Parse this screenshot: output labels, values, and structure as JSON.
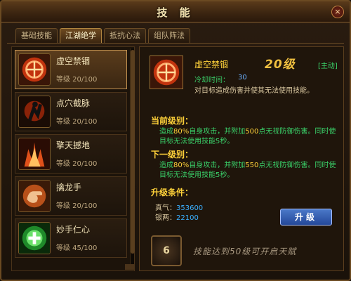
{
  "window": {
    "title": "技 能",
    "close_label": "×"
  },
  "tabs": [
    {
      "label": "基础技能",
      "active": false
    },
    {
      "label": "江湖绝学",
      "active": true
    },
    {
      "label": "抵抗心法",
      "active": false
    },
    {
      "label": "组队阵法",
      "active": false
    }
  ],
  "skills": [
    {
      "name": "虚空禁锢",
      "level": "等级 20/100",
      "selected": true,
      "icon": "knot-icon"
    },
    {
      "name": "点穴截脉",
      "level": "等级 20/100",
      "selected": false,
      "icon": "strike-icon"
    },
    {
      "name": "擎天撼地",
      "level": "等级 20/100",
      "selected": false,
      "icon": "fire-burst-icon"
    },
    {
      "name": "擒龙手",
      "level": "等级 20/100",
      "selected": false,
      "icon": "grab-hand-icon"
    },
    {
      "name": "妙手仁心",
      "level": "等级 45/100",
      "selected": false,
      "icon": "heal-cross-icon"
    }
  ],
  "detail": {
    "name": "虚空禁锢",
    "level": "20级",
    "type": "[主动]",
    "cooldown_label": "冷却时间：",
    "cooldown_value": "30",
    "description": "对目标造成伤害并使其无法使用技能。",
    "current_label": "当前级别：",
    "current_effect_pre": "造成",
    "current_effect_pct": "80%",
    "current_effect_mid": "自身攻击，并附加",
    "current_effect_add": "500",
    "current_effect_post": "点无视防御伤害。同时使目标无法使用技能5秒。",
    "next_label": "下一级别：",
    "next_effect_pre": "造成",
    "next_effect_pct": "80%",
    "next_effect_mid": "自身攻击，并附加",
    "next_effect_add": "550",
    "next_effect_post": "点无视防御伤害。同时使目标无法使用技能5秒。",
    "upgrade_label": "升级条件：",
    "zhenqi_label": "真气：",
    "zhenqi_value": "353600",
    "silver_label": "银两：",
    "silver_value": "22100",
    "upgrade_button": "升级",
    "seal_number": "6",
    "hint": "技能达到50级可开启天赋"
  },
  "colors": {
    "accent_gold": "#ffd23a",
    "effect_green": "#3ad26a",
    "value_blue": "#3ab0ff"
  }
}
